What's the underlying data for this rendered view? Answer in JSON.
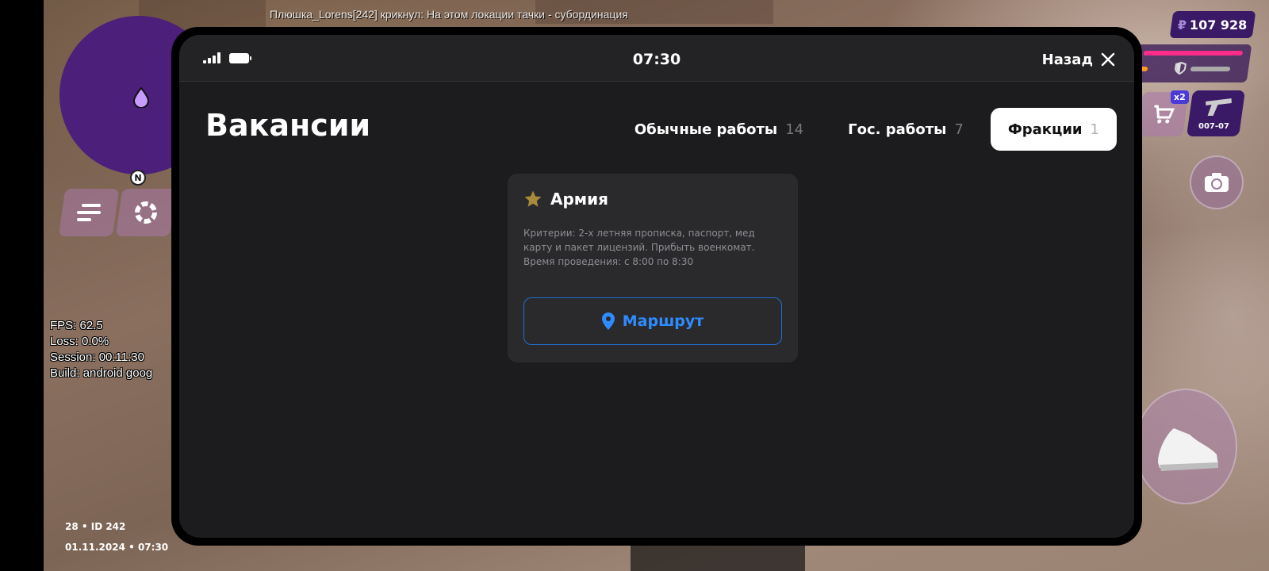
{
  "hud": {
    "chat_line": "Плюшка_Lorens[242] крикнул: На этом локации тачки - субординация",
    "fps_lines": [
      "FPS: 62.5",
      "Loss: 0.0%",
      "Session: 00:11:30",
      "Build: android goog"
    ],
    "player_id": "28 • ID 242",
    "datetime": "01.11.2024 • 07:30",
    "money_currency": "₽",
    "money_value": "107 928",
    "north_label": "N",
    "x2_badge": "x2",
    "weapon_ammo": "007-07",
    "health_fraction": 1.0,
    "armor_fraction": 0.75,
    "colors": {
      "minimap": "#4b1f7a",
      "health": "#ff2d8a",
      "panel": "#3a1a66"
    }
  },
  "phone": {
    "status": {
      "clock": "07:30",
      "signal_icon": "signal-icon",
      "battery_icon": "battery-icon"
    },
    "back_label": "Назад",
    "page_title": "Вакансии",
    "tabs": [
      {
        "label": "Обычные работы",
        "count": "14",
        "active": false
      },
      {
        "label": "Гос. работы",
        "count": "7",
        "active": false
      },
      {
        "label": "Фракции",
        "count": "1",
        "active": true
      }
    ],
    "vacancy": {
      "icon": "star-icon",
      "title": "Армия",
      "description_lines": [
        "Критерии: 2-х летняя прописка, паспорт, мед",
        "карту и пакет лицензий. Прибыть военкомат.",
        "Время проведения: с 8:00 по 8:30"
      ],
      "route_label": "Маршрут",
      "route_icon": "location-pin-icon",
      "accent": "#2e8cff"
    }
  }
}
